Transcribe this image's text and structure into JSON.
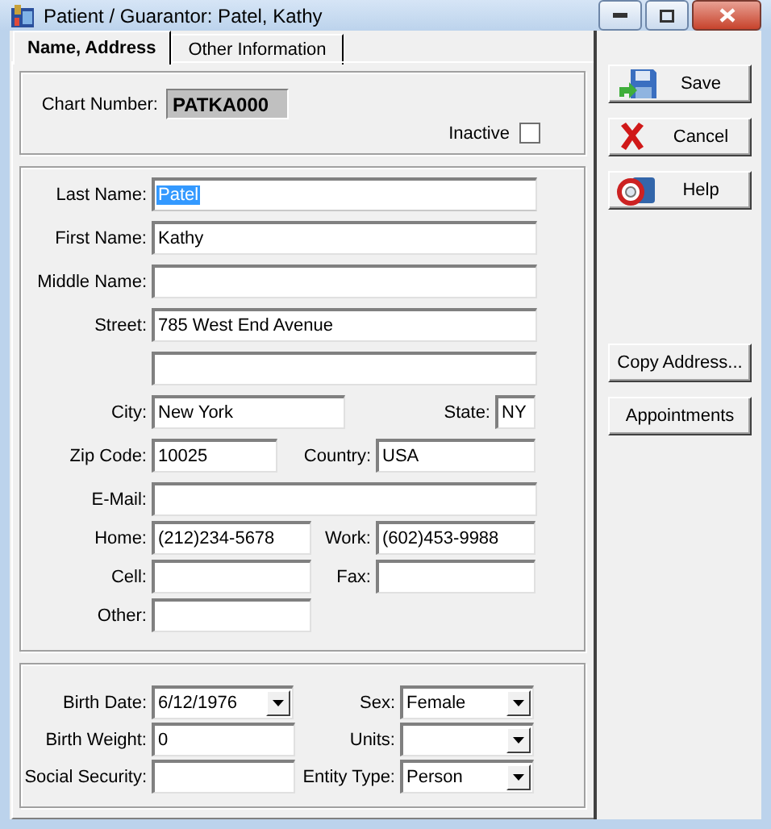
{
  "window": {
    "title": "Patient / Guarantor: Patel, Kathy"
  },
  "tabs": [
    {
      "label": "Name, Address",
      "selected": true
    },
    {
      "label": "Other Information",
      "selected": false
    }
  ],
  "chart_number": {
    "label": "Chart Number:",
    "value": "PATKA000"
  },
  "inactive": {
    "label": "Inactive",
    "checked": false
  },
  "address_rows": [
    [
      {
        "label": "Last Name:",
        "value": "Patel",
        "highlighted": true
      }
    ],
    [
      {
        "label": "First Name:",
        "value": "Kathy",
        "highlighted": false
      }
    ],
    [
      {
        "label": "Middle Name:",
        "highlighted": false
      }
    ],
    [
      {
        "label": "Street:",
        "value": "785 West End Avenue",
        "highlighted": false
      }
    ],
    [
      {
        "highlighted": false
      }
    ],
    [
      {
        "label": "City:",
        "value": "New York",
        "highlighted": false
      },
      {
        "label": "State:",
        "value": "NY",
        "highlighted": false
      }
    ],
    [
      {
        "label": "Zip Code:",
        "value": "10025",
        "highlighted": false
      },
      {
        "label": "Country:",
        "value": "USA",
        "highlighted": false
      }
    ],
    [
      {
        "label": "E-Mail:",
        "highlighted": false
      }
    ],
    [
      {
        "label": "Home:",
        "value": "(212)234-5678",
        "highlighted": false
      },
      {
        "label": "Work:",
        "value": "(602)453-9988",
        "highlighted": false
      }
    ],
    [
      {
        "label": "Cell:",
        "highlighted": false
      },
      {
        "label": "Fax:",
        "highlighted": false
      }
    ],
    [
      {
        "label": "Other:",
        "highlighted": false
      }
    ]
  ],
  "demographic_rows": [
    [
      {
        "label": "Birth Date:",
        "value": "6/12/1976",
        "kind": "dropdown"
      },
      {
        "label": "Sex:",
        "value": "Female",
        "kind": "dropdown"
      }
    ],
    [
      {
        "label": "Birth Weight:",
        "value": "0",
        "kind": "text"
      },
      {
        "label": "Units:",
        "kind": "dropdown"
      }
    ],
    [
      {
        "label": "Social Security:",
        "kind": "text"
      },
      {
        "label": "Entity Type:",
        "value": "Person",
        "kind": "dropdown"
      }
    ]
  ],
  "action_buttons": [
    {
      "label": "Save",
      "kind": "save"
    },
    {
      "label": "Cancel",
      "kind": "cancel"
    },
    {
      "label": "Help",
      "kind": "help"
    }
  ],
  "side_buttons": [
    {
      "label": "Copy Address..."
    },
    {
      "label": "Appointments"
    }
  ]
}
